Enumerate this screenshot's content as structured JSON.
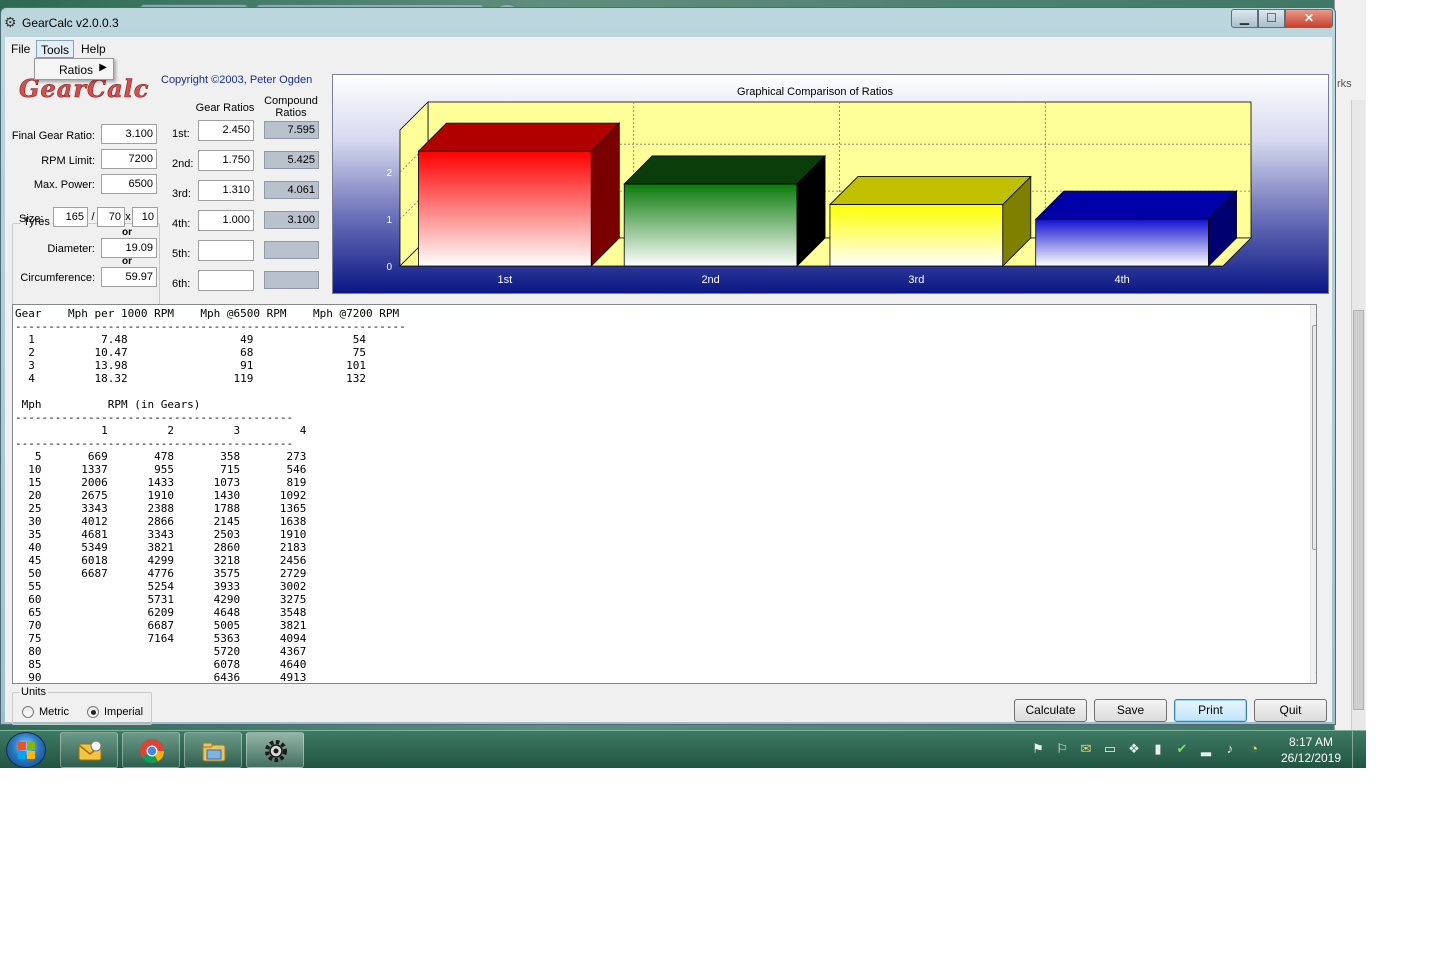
{
  "window": {
    "title": "GearCalc  v2.0.0.3"
  },
  "menu": {
    "file": "File",
    "tools": "Tools",
    "help": "Help",
    "tools_dropdown_item": "Ratios"
  },
  "logo_text": "GearCalc",
  "copyright": "Copyright ©2003, Peter Ogden",
  "form": {
    "final_gear_ratio_label": "Final Gear Ratio:",
    "final_gear_ratio": "3.100",
    "rpm_limit_label": "RPM Limit:",
    "rpm_limit": "7200",
    "max_power_label": "Max. Power:",
    "max_power": "6500",
    "tyres_legend": "Tyres",
    "size_label": "Size:",
    "tyre_width": "165",
    "tyre_profile": "70",
    "tyre_rim": "10",
    "slash": "/",
    "x": "x",
    "or": "or",
    "diameter_label": "Diameter:",
    "diameter": "19.09",
    "circumference_label": "Circumference:",
    "circumference": "59.97"
  },
  "ratios": {
    "gear_ratios_header": "Gear Ratios",
    "compound_header_1": "Compound",
    "compound_header_2": "Ratios",
    "rows": [
      {
        "label": "1st:",
        "ratio": "2.450",
        "compound": "7.595"
      },
      {
        "label": "2nd:",
        "ratio": "1.750",
        "compound": "5.425"
      },
      {
        "label": "3rd:",
        "ratio": "1.310",
        "compound": "4.061"
      },
      {
        "label": "4th:",
        "ratio": "1.000",
        "compound": "3.100"
      },
      {
        "label": "5th:",
        "ratio": "",
        "compound": ""
      },
      {
        "label": "6th:",
        "ratio": "",
        "compound": ""
      }
    ]
  },
  "chart_data": {
    "type": "bar",
    "title": "Graphical Comparison of Ratios",
    "categories": [
      "1st",
      "2nd",
      "3rd",
      "4th"
    ],
    "values": [
      2.45,
      1.75,
      1.31,
      1.0
    ],
    "yticks": [
      "0",
      "1",
      "2"
    ],
    "ylim": [
      0,
      2.9
    ],
    "colors": [
      "#ff0000",
      "#0a7a0a",
      "#ffff00",
      "#1010d0"
    ],
    "side_colors": [
      "#7a0000",
      "#000000",
      "#808000",
      "#000070"
    ],
    "top_colors": [
      "#b00000",
      "#0a3d0a",
      "#c0c000",
      "#0000a8"
    ],
    "wall_color": "#ffff99"
  },
  "output_lines": [
    "Gear    Mph per 1000 RPM    Mph @6500 RPM    Mph @7200 RPM",
    "-----------------------------------------------------------",
    "  1          7.48                 49               54",
    "  2         10.47                 68               75",
    "  3         13.98                 91              101",
    "  4         18.32                119              132",
    "",
    " Mph          RPM (in Gears)",
    "------------------------------------------",
    "             1         2         3         4",
    "------------------------------------------",
    "   5       669       478       358       273",
    "  10      1337       955       715       546",
    "  15      2006      1433      1073       819",
    "  20      2675      1910      1430      1092",
    "  25      3343      2388      1788      1365",
    "  30      4012      2866      2145      1638",
    "  35      4681      3343      2503      1910",
    "  40      5349      3821      2860      2183",
    "  45      6018      4299      3218      2456",
    "  50      6687      4776      3575      2729",
    "  55                5254      3933      3002",
    "  60                5731      4290      3275",
    "  65                6209      4648      3548",
    "  70                6687      5005      3821",
    "  75                7164      5363      4094",
    "  80                          5720      4367",
    "  85                          6078      4640",
    "  90                          6436      4913"
  ],
  "units": {
    "legend": "Units",
    "metric": "Metric",
    "imperial": "Imperial",
    "selected": "Imperial"
  },
  "buttons": {
    "calculate": "Calculate",
    "save": "Save",
    "print": "Print",
    "quit": "Quit"
  },
  "taskbar": {
    "time": "8:17 AM",
    "date": "26/12/2019",
    "apps": [
      "outlook-icon",
      "chrome-icon",
      "file-explorer-icon",
      "gearcalc-icon"
    ]
  },
  "background_window": {
    "partial_text": "rks"
  }
}
